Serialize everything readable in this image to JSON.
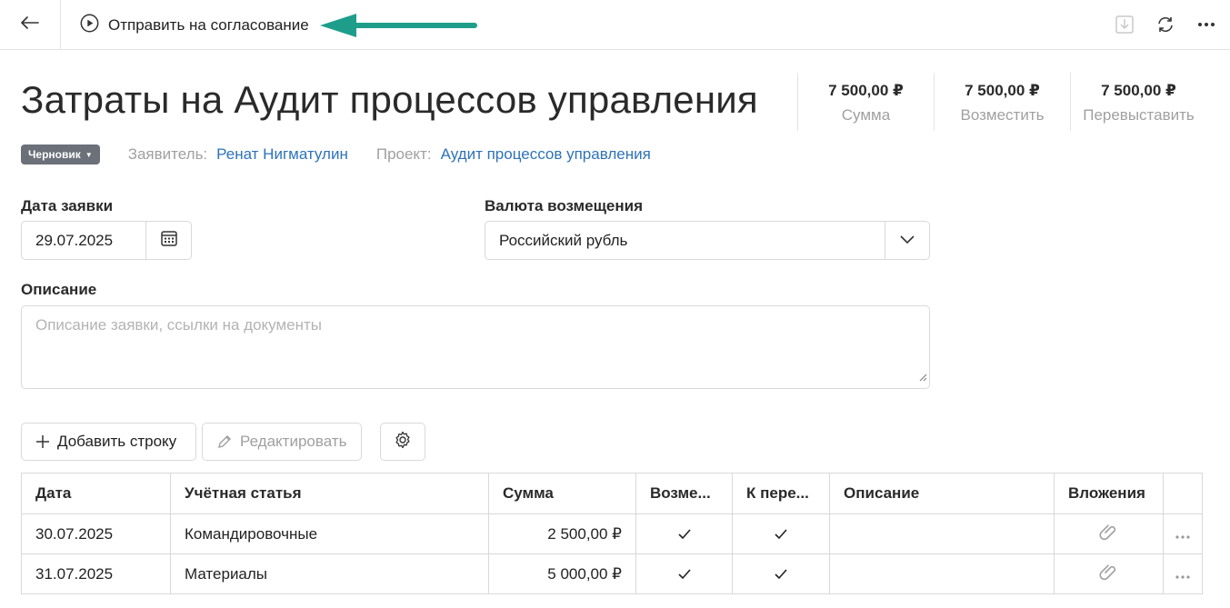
{
  "toolbar": {
    "send_label": "Отправить на согласование"
  },
  "header": {
    "title": "Затраты на Аудит процессов управления",
    "totals": [
      {
        "value": "7 500,00 ₽",
        "caption": "Сумма"
      },
      {
        "value": "7 500,00 ₽",
        "caption": "Возместить"
      },
      {
        "value": "7 500,00 ₽",
        "caption": "Перевыставить"
      }
    ],
    "status": "Черновик",
    "applicant_label": "Заявитель:",
    "applicant": "Ренат Нигматулин",
    "project_label": "Проект:",
    "project": "Аудит процессов управления"
  },
  "form": {
    "date_label": "Дата заявки",
    "date_value": "29.07.2025",
    "currency_label": "Валюта возмещения",
    "currency_value": "Российский рубль",
    "description_label": "Описание",
    "description_placeholder": "Описание заявки, ссылки на документы"
  },
  "actions": {
    "add_row": "Добавить строку",
    "edit": "Редактировать"
  },
  "table": {
    "columns": [
      "Дата",
      "Учётная статья",
      "Сумма",
      "Возме...",
      "К пере...",
      "Описание",
      "Вложения"
    ],
    "rows": [
      {
        "date": "30.07.2025",
        "item": "Командировочные",
        "amount": "2 500,00 ₽",
        "reimburse": true,
        "rebill": true,
        "description": ""
      },
      {
        "date": "31.07.2025",
        "item": "Материалы",
        "amount": "5 000,00 ₽",
        "reimburse": true,
        "rebill": true,
        "description": ""
      }
    ]
  },
  "colors": {
    "accent_link": "#2e73b8",
    "annotation_arrow": "#1e9e8a",
    "badge_bg": "#6b7079"
  },
  "icons": [
    "back-arrow-icon",
    "play-circle-icon",
    "download-icon",
    "refresh-icon",
    "more-icon",
    "calendar-icon",
    "chevron-down-icon",
    "plus-icon",
    "pencil-icon",
    "gear-icon",
    "check-icon",
    "paperclip-icon"
  ]
}
